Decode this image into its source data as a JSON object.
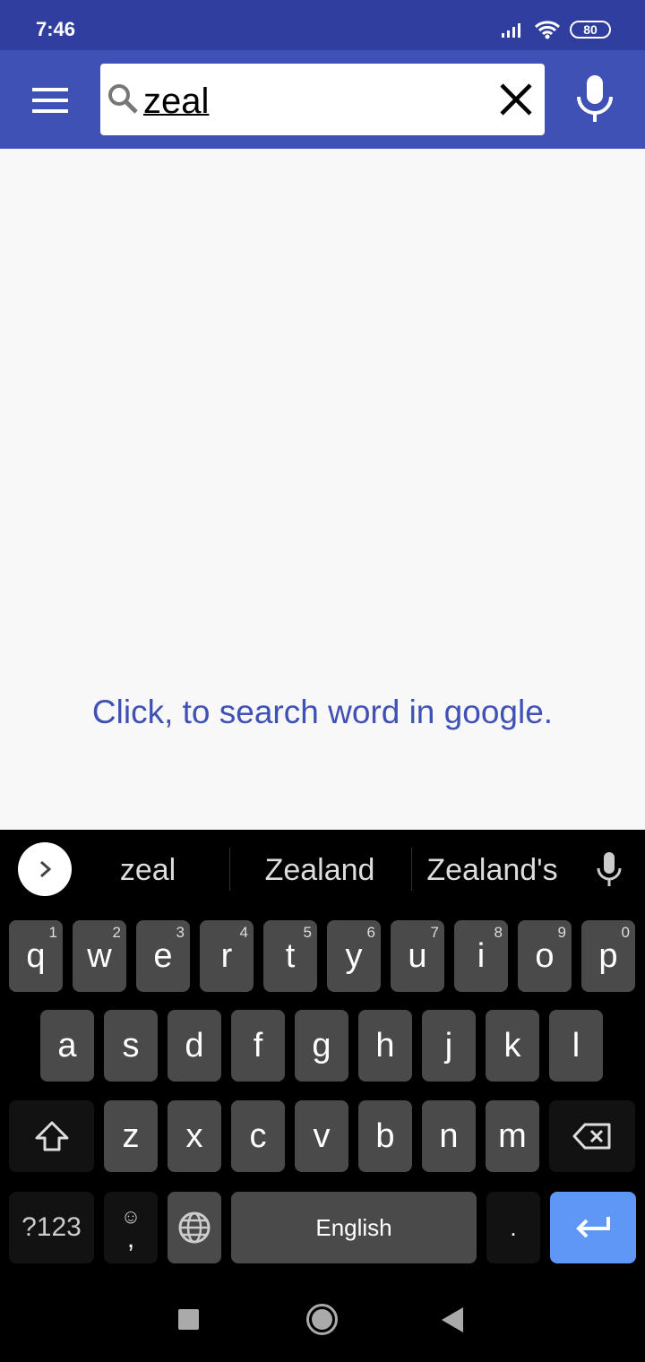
{
  "status": {
    "time": "7:46",
    "battery": "80"
  },
  "search": {
    "value": "zeal"
  },
  "content": {
    "link_text": "Click, to search word in google."
  },
  "keyboard": {
    "suggestions": [
      "zeal",
      "Zealand",
      "Zealand's"
    ],
    "row1": [
      {
        "k": "q",
        "n": "1"
      },
      {
        "k": "w",
        "n": "2"
      },
      {
        "k": "e",
        "n": "3"
      },
      {
        "k": "r",
        "n": "4"
      },
      {
        "k": "t",
        "n": "5"
      },
      {
        "k": "y",
        "n": "6"
      },
      {
        "k": "u",
        "n": "7"
      },
      {
        "k": "i",
        "n": "8"
      },
      {
        "k": "o",
        "n": "9"
      },
      {
        "k": "p",
        "n": "0"
      }
    ],
    "row2": [
      "a",
      "s",
      "d",
      "f",
      "g",
      "h",
      "j",
      "k",
      "l"
    ],
    "row3": [
      "z",
      "x",
      "c",
      "v",
      "b",
      "n",
      "m"
    ],
    "symbols": "?123",
    "comma": ",",
    "space": "English",
    "period": ".",
    "colors": {
      "enter": "#5e97f6",
      "key": "#4a4a4a"
    }
  }
}
